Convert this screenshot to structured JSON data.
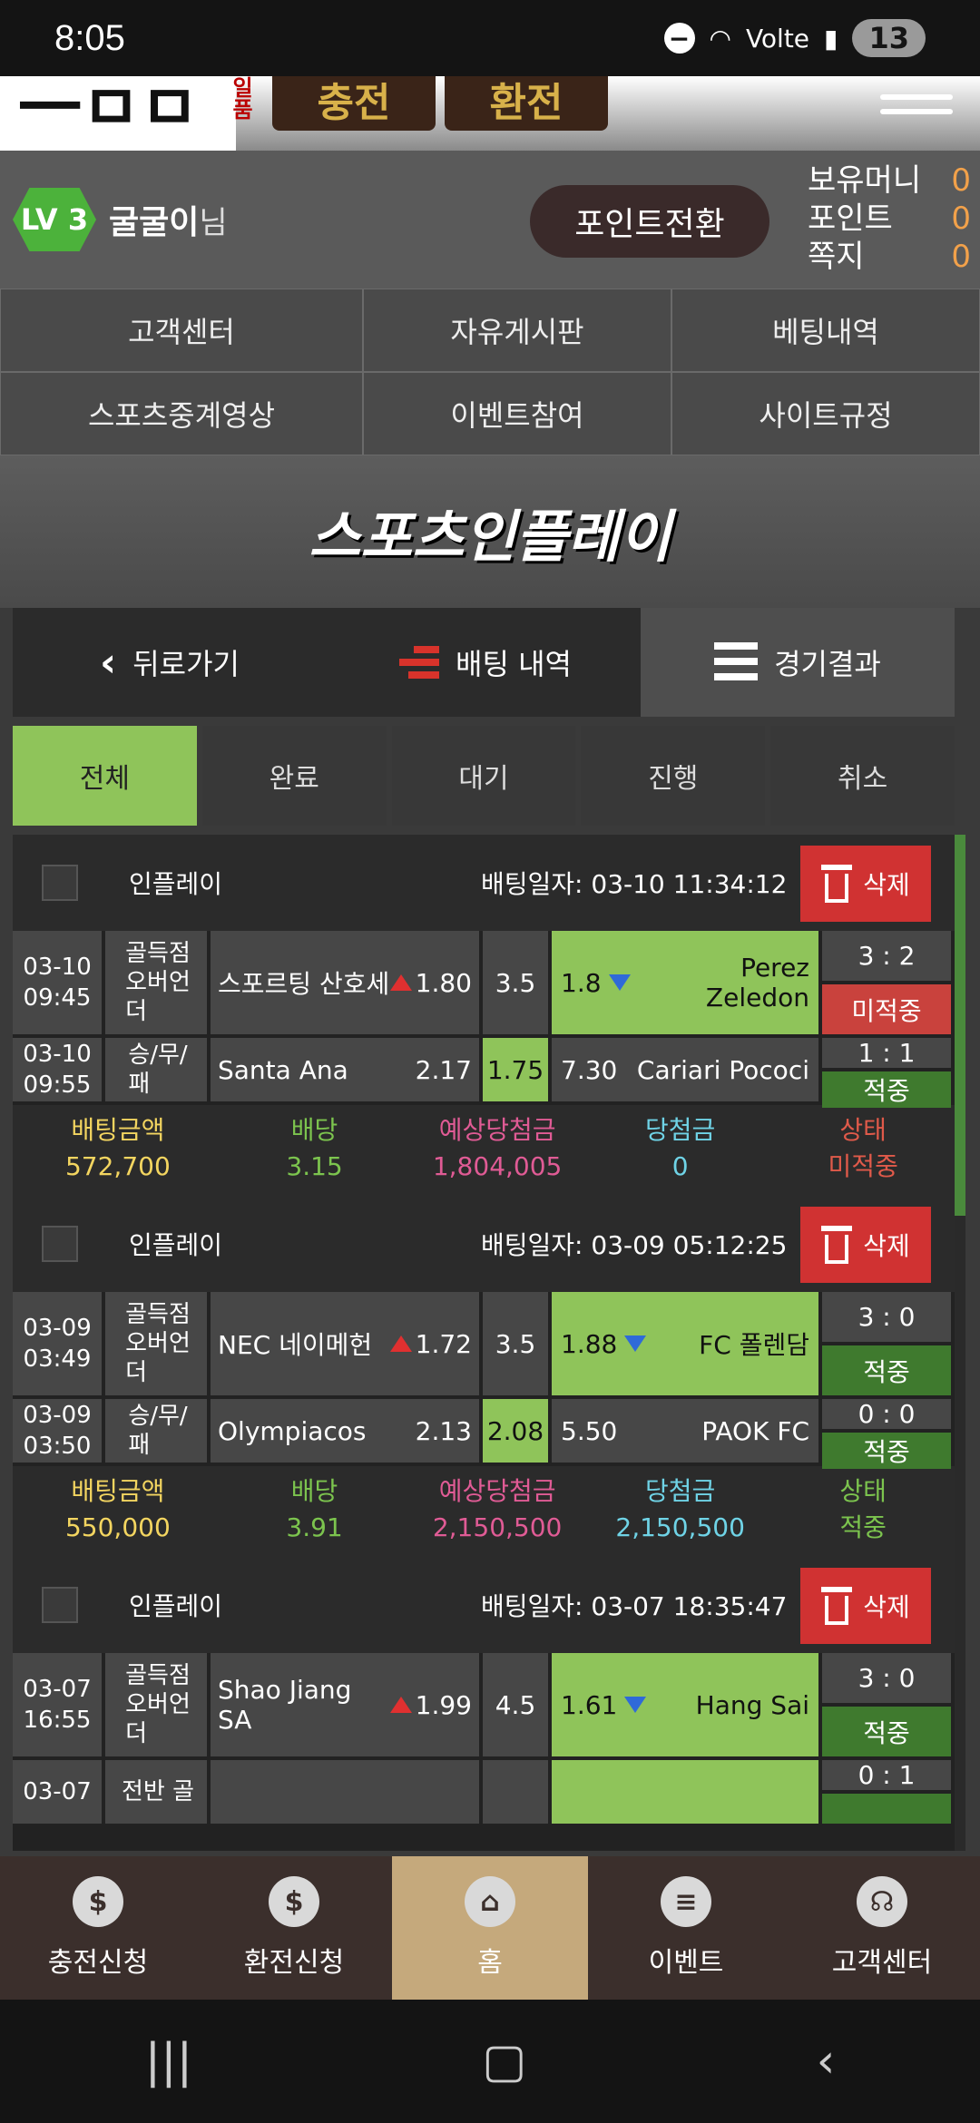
{
  "status": {
    "time": "8:05",
    "battery": "13",
    "network": "Volte"
  },
  "banner": {
    "btn1": "충전",
    "btn2": "환전"
  },
  "user": {
    "level": "LV 3",
    "name": "굴굴이",
    "suffix": "님",
    "points_button": "포인트전환",
    "balances": [
      {
        "label": "보유머니",
        "value": "0"
      },
      {
        "label": "포인트",
        "value": "0"
      },
      {
        "label": "쪽지",
        "value": "0"
      }
    ]
  },
  "nav": [
    "고객센터",
    "자유게시판",
    "베팅내역",
    "스포츠중계영상",
    "이벤트참여",
    "사이트규정"
  ],
  "page_title": "스포츠인플레이",
  "tabs": {
    "back": "뒤로가기",
    "history": "배팅 내역",
    "results": "경기결과"
  },
  "filters": [
    "전체",
    "완료",
    "대기",
    "진행",
    "취소"
  ],
  "summary_labels": {
    "amount": "배팅금액",
    "odds": "배당",
    "expected": "예상당첨금",
    "won": "당첨금",
    "status": "상태"
  },
  "delete_label": "삭제",
  "bets": [
    {
      "type": "인플레이",
      "date": "배팅일자: 03-10 11:34:12",
      "games": [
        {
          "time": "03-10\n09:45",
          "market": "골득점\n오버언\n더",
          "home": "스포르팅 산호세",
          "home_odds": "1.80",
          "home_arrow": "up",
          "line": "3.5",
          "line_sel": false,
          "away_odds": "1.8",
          "away_arrow": "down",
          "away": "Perez Zeledon",
          "away_sel": true,
          "score": "3 : 2",
          "state": "미적중",
          "state_hit": false
        },
        {
          "time": "03-10\n09:55",
          "market": "승/무/\n패",
          "home": "Santa Ana",
          "home_odds": "2.17",
          "home_arrow": "",
          "line": "1.75",
          "line_sel": true,
          "away_odds": "7.30",
          "away_arrow": "",
          "away": "Cariari Pococi",
          "away_sel": false,
          "score": "1 : 1",
          "state": "적중",
          "state_hit": true
        }
      ],
      "amount": "572,700",
      "odds": "3.15",
      "expected": "1,804,005",
      "won": "0",
      "status": "미적중",
      "status_hit": false
    },
    {
      "type": "인플레이",
      "date": "배팅일자: 03-09 05:12:25",
      "games": [
        {
          "time": "03-09\n03:49",
          "market": "골득점\n오버언\n더",
          "home": "NEC 네이메헌",
          "home_odds": "1.72",
          "home_arrow": "up",
          "line": "3.5",
          "line_sel": false,
          "away_odds": "1.88",
          "away_arrow": "down",
          "away": "FC 폴렌담",
          "away_sel": true,
          "score": "3 : 0",
          "state": "적중",
          "state_hit": true
        },
        {
          "time": "03-09\n03:50",
          "market": "승/무/\n패",
          "home": "Olympiacos",
          "home_odds": "2.13",
          "home_arrow": "",
          "line": "2.08",
          "line_sel": true,
          "away_odds": "5.50",
          "away_arrow": "",
          "away": "PAOK FC",
          "away_sel": false,
          "score": "0 : 0",
          "state": "적중",
          "state_hit": true
        }
      ],
      "amount": "550,000",
      "odds": "3.91",
      "expected": "2,150,500",
      "won": "2,150,500",
      "status": "적중",
      "status_hit": true
    },
    {
      "type": "인플레이",
      "date": "배팅일자: 03-07 18:35:47",
      "games": [
        {
          "time": "03-07\n16:55",
          "market": "골득점\n오버언\n더",
          "home": "Shao Jiang SA",
          "home_odds": "1.99",
          "home_arrow": "up",
          "line": "4.5",
          "line_sel": false,
          "away_odds": "1.61",
          "away_arrow": "down",
          "away": "Hang Sai",
          "away_sel": true,
          "score": "3 : 0",
          "state": "적중",
          "state_hit": true
        },
        {
          "time": "03-07",
          "market": "전반 골",
          "home": "",
          "home_odds": "",
          "home_arrow": "",
          "line": "",
          "line_sel": false,
          "away_odds": "",
          "away_arrow": "",
          "away": "",
          "away_sel": true,
          "score": "0 : 1",
          "state": "",
          "state_hit": true
        }
      ],
      "amount": "",
      "odds": "",
      "expected": "",
      "won": "",
      "status": "",
      "status_hit": true
    }
  ],
  "bottom_nav": [
    "충전신청",
    "환전신청",
    "홈",
    "이벤트",
    "고객센터"
  ],
  "colors": {
    "accent_green": "#8fc45a",
    "delete_red": "#d03232",
    "hit_green": "#3f7a2e",
    "miss_red": "#c9423d"
  }
}
